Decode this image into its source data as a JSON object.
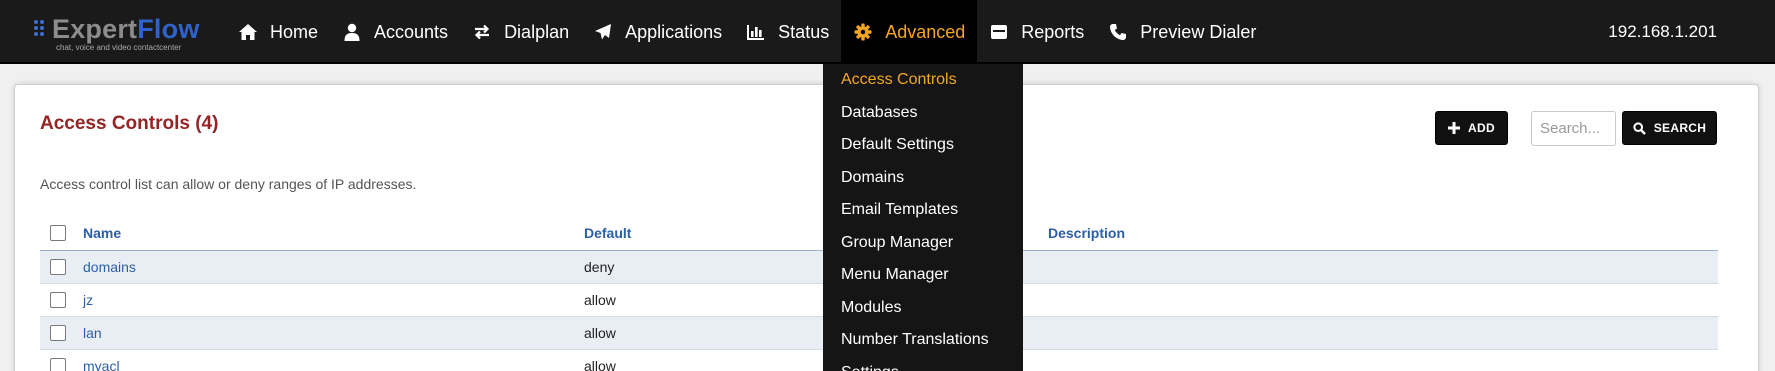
{
  "app": {
    "logo_part1": "Expert",
    "logo_part2": "Flow",
    "tagline": "chat, voice and video contactcenter",
    "ip": "192.168.1.201"
  },
  "nav": {
    "items": [
      {
        "label": "Home",
        "icon": "home-icon"
      },
      {
        "label": "Accounts",
        "icon": "user-icon"
      },
      {
        "label": "Dialplan",
        "icon": "exchange-icon"
      },
      {
        "label": "Applications",
        "icon": "paper-plane-icon"
      },
      {
        "label": "Status",
        "icon": "bar-chart-icon"
      },
      {
        "label": "Advanced",
        "icon": "gear-icon",
        "active": true
      },
      {
        "label": "Reports",
        "icon": "report-icon"
      },
      {
        "label": "Preview Dialer",
        "icon": "phone-icon"
      }
    ]
  },
  "advanced_menu": {
    "items": [
      "Access Controls",
      "Databases",
      "Default Settings",
      "Domains",
      "Email Templates",
      "Group Manager",
      "Menu Manager",
      "Modules",
      "Number Translations",
      "Settings"
    ],
    "active_index": 0
  },
  "page": {
    "title": "Access Controls (4)",
    "description": "Access control list can allow or deny ranges of IP addresses.",
    "add_label": "ADD",
    "search_label": "SEARCH",
    "search_placeholder": "Search...",
    "search_value": ""
  },
  "table": {
    "headers": {
      "name": "Name",
      "default": "Default",
      "description": "Description"
    },
    "rows": [
      {
        "name": "domains",
        "default": "deny",
        "description": ""
      },
      {
        "name": "jz",
        "default": "allow",
        "description": ""
      },
      {
        "name": "lan",
        "default": "allow",
        "description": ""
      },
      {
        "name": "myacl",
        "default": "allow",
        "description": ""
      }
    ]
  },
  "colors": {
    "topbar": "#1a1a1a",
    "accent": "#f5a623",
    "title": "#952424",
    "link": "#2d5fa5"
  }
}
